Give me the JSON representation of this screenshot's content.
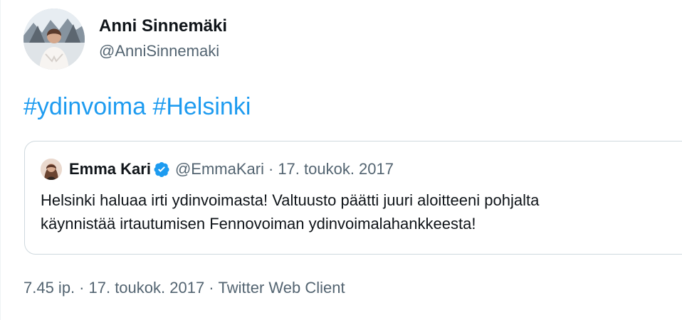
{
  "author": {
    "display_name": "Anni Sinnemäki",
    "handle": "@AnniSinnemaki"
  },
  "tweet": {
    "hashtags": [
      "#ydinvoima",
      "#Helsinki"
    ]
  },
  "quoted": {
    "display_name": "Emma Kari",
    "handle": "@EmmaKari",
    "separator": "·",
    "date": "17. toukok. 2017",
    "text_lines": [
      "Helsinki haluaa irti ydinvoimasta!  Valtuusto päätti juuri aloitteeni pohjalta",
      "käynnistää irtautumisen Fennovoiman ydinvoimalahankkeesta!"
    ],
    "verified_icon": "verified-badge-icon",
    "verified_color": "#1d9bf0"
  },
  "meta": {
    "time": "7.45 ip.",
    "separator": "·",
    "date": "17. toukok. 2017",
    "source": "Twitter Web Client"
  },
  "colors": {
    "link": "#1d9bf0",
    "secondary_text": "#536471",
    "border": "#cfd9de"
  },
  "icons": {
    "author_avatar": "avatar",
    "quoted_avatar": "avatar"
  }
}
